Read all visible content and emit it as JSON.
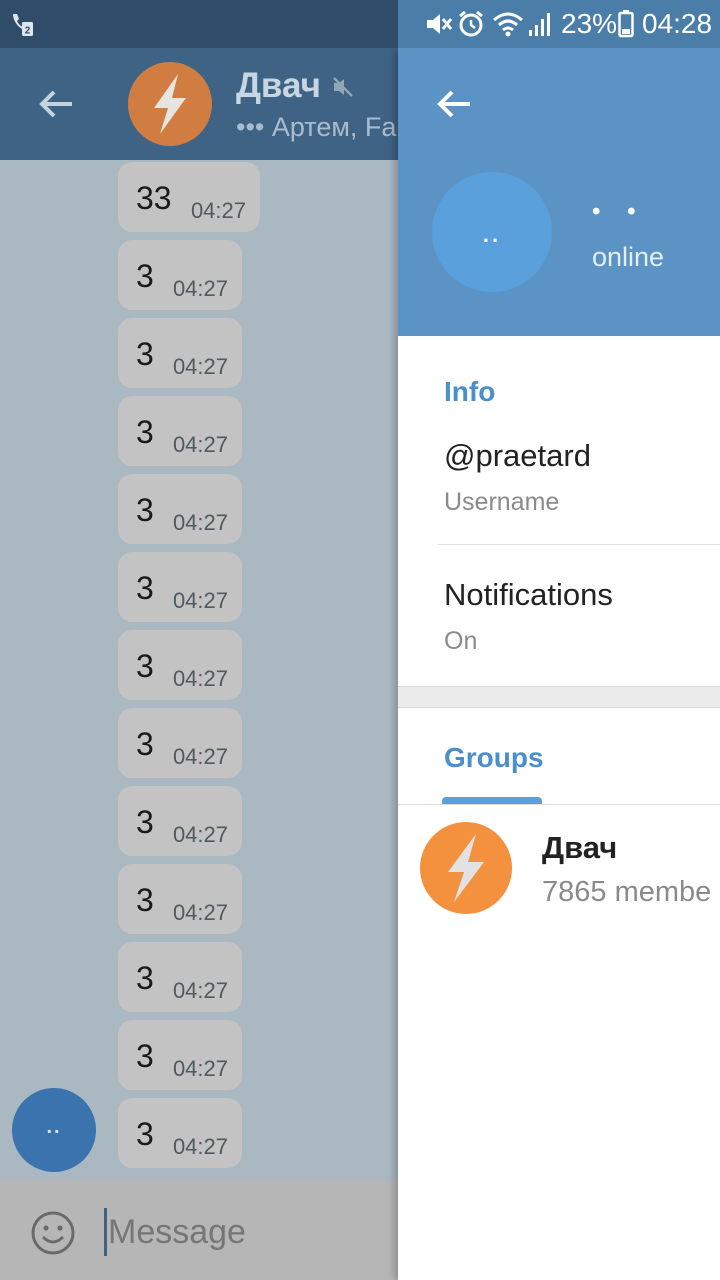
{
  "status_bar": {
    "left_icon": "call-transfer-sim2-icon",
    "battery_percent": "23%",
    "time": "04:28",
    "icons": [
      "mute-icon",
      "alarm-icon",
      "wifi-icon",
      "signal-icon",
      "battery-icon"
    ]
  },
  "chat": {
    "title": "Двач",
    "subtitle": "••• Артем, Fa",
    "muted": true,
    "messages": [
      {
        "text": "33",
        "time": "04:27"
      },
      {
        "text": "3",
        "time": "04:27"
      },
      {
        "text": "3",
        "time": "04:27"
      },
      {
        "text": "3",
        "time": "04:27"
      },
      {
        "text": "3",
        "time": "04:27"
      },
      {
        "text": "3",
        "time": "04:27"
      },
      {
        "text": "3",
        "time": "04:27"
      },
      {
        "text": "3",
        "time": "04:27"
      },
      {
        "text": "3",
        "time": "04:27"
      },
      {
        "text": "3",
        "time": "04:27"
      },
      {
        "text": "3",
        "time": "04:27"
      },
      {
        "text": "3",
        "time": "04:27"
      },
      {
        "text": "3",
        "time": "04:27"
      }
    ],
    "fab_label": "..",
    "input_placeholder": "Message"
  },
  "profile": {
    "avatar_label": "..",
    "name": "• •",
    "status": "online",
    "info_title": "Info",
    "username": "@praetard",
    "username_label": "Username",
    "notifications_title": "Notifications",
    "notifications_value": "On",
    "groups_title": "Groups",
    "groups": [
      {
        "name": "Двач",
        "members": "7865 membe"
      }
    ]
  },
  "colors": {
    "header_blue": "#5b93c4",
    "accent_blue": "#4a8fcb",
    "dimmed_header": "#3e6384",
    "group_avatar_orange": "#f3913f"
  }
}
